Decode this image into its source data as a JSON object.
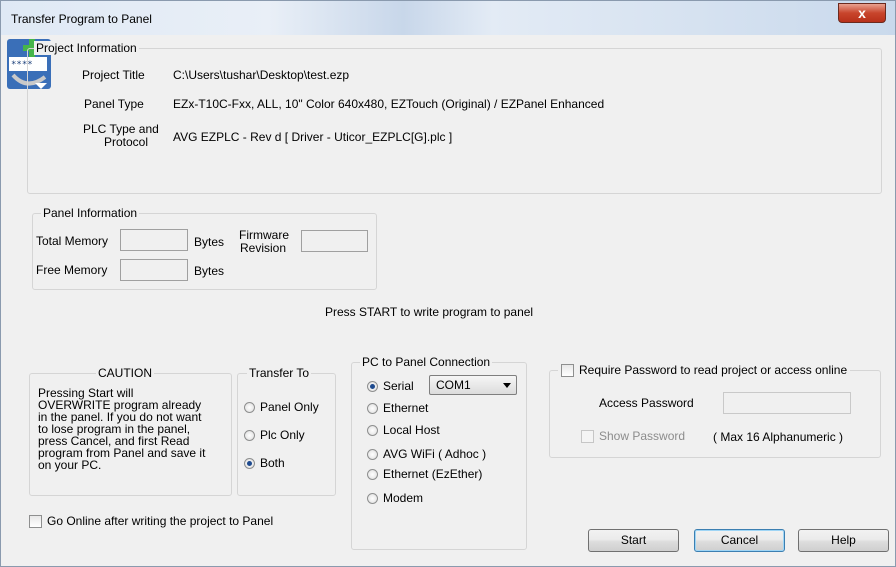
{
  "window": {
    "title": "Transfer Program to Panel",
    "close_glyph": "x"
  },
  "project_info": {
    "caption": "Project Information",
    "title_label": "Project Title",
    "title_value": "C:\\Users\\tushar\\Desktop\\test.ezp",
    "panel_type_label": "Panel Type",
    "panel_type_value": "EZx-T10C-Fxx, ALL, 10\" Color 640x480, EZTouch (Original) / EZPanel Enhanced",
    "plc_label_line1": "PLC Type and",
    "plc_label_line2": "Protocol",
    "plc_value": "AVG EZPLC - Rev d  [ Driver - Uticor_EZPLC[G].plc ]"
  },
  "panel_info": {
    "caption": "Panel Information",
    "total_memory_label": "Total Memory",
    "total_memory_value": "",
    "bytes_label": "Bytes",
    "firmware_label_line1": "Firmware",
    "firmware_label_line2": "Revision",
    "firmware_value": "",
    "free_memory_label": "Free Memory",
    "free_memory_value": "",
    "bytes_label2": "Bytes"
  },
  "instruction": "Press START to write program to panel",
  "caution": {
    "caption": "CAUTION",
    "lines": [
      "Pressing Start will",
      "OVERWRITE program already",
      "in the panel. If you do not want",
      "to lose program in the panel,",
      "press Cancel, and first Read",
      "program from Panel and save it",
      "on your PC."
    ]
  },
  "transfer_to": {
    "caption": "Transfer To",
    "options": [
      {
        "label": "Panel Only",
        "selected": false
      },
      {
        "label": "Plc Only",
        "selected": false
      },
      {
        "label": "Both",
        "selected": true
      }
    ]
  },
  "connection": {
    "caption": "PC to Panel Connection",
    "options": [
      {
        "label": "Serial",
        "selected": true
      },
      {
        "label": "Ethernet",
        "selected": false
      },
      {
        "label": "Local Host",
        "selected": false
      },
      {
        "label": "AVG WiFi ( Adhoc )",
        "selected": false
      },
      {
        "label": "Ethernet (EzEther)",
        "selected": false
      },
      {
        "label": "Modem",
        "selected": false
      }
    ],
    "port_value": "COM1"
  },
  "password": {
    "require_label": "Require Password to read project or access online",
    "access_label": "Access Password",
    "access_value": "",
    "show_label": "Show Password",
    "hint": "( Max 16 Alphanumeric )"
  },
  "go_online_label": "Go Online after writing the project to Panel",
  "buttons": {
    "start": "Start",
    "cancel": "Cancel",
    "help": "Help"
  },
  "colors": {
    "accent": "#1e4a8e",
    "close": "#c8452c"
  }
}
